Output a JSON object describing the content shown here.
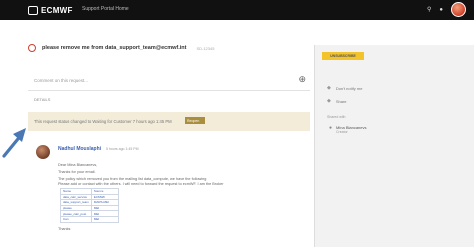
{
  "topbar": {
    "logo_text": "ECMWF",
    "portal_name": "Support Portal Home",
    "search_icon": "search-icon",
    "notification_icon": "bell-icon"
  },
  "request": {
    "title": "please remove me from data_support_team@ecmwf.int",
    "id": "SD-12345",
    "comment_placeholder": "Comment on this request...",
    "share_label": "Share",
    "details_label": "DETAILS"
  },
  "notice": {
    "text": "This request status changed to Waiting for Customer 7 hours ago 1:45 PM",
    "badge": "Reopen"
  },
  "activity": {
    "author": "Nadhul Mouslaphi",
    "timestamp": "5 hours ago 1:45 PM",
    "lines": [
      "Dear Mina Blancanevs,",
      "Thanks for your email.",
      "The policy which removed you from the mailing list data_compute, we have the following",
      "Please add or contact with the others. I will need to forward the request to ecmWF. I am the Broker"
    ],
    "table": [
      [
        "Name",
        "Source"
      ],
      [
        "data_calc_service",
        "ECMWF"
      ],
      [
        "data_support_team",
        "MARS-MEI"
      ],
      [
        "please",
        "MEI"
      ],
      [
        "please_calc_post",
        "MEI"
      ],
      [
        "Can",
        "MEI"
      ]
    ],
    "sign_off": "Thanks"
  },
  "sidebar": {
    "unsubscribe_label": "UNSUBSCRIBE",
    "items": [
      {
        "icon": "bell-icon",
        "label": "Don't notify me"
      },
      {
        "icon": "share-icon",
        "label": "Share"
      }
    ],
    "shared_with_label": "Shared with",
    "shared_with_name": "Mina Blancanevs",
    "shared_with_role": "Creator"
  }
}
